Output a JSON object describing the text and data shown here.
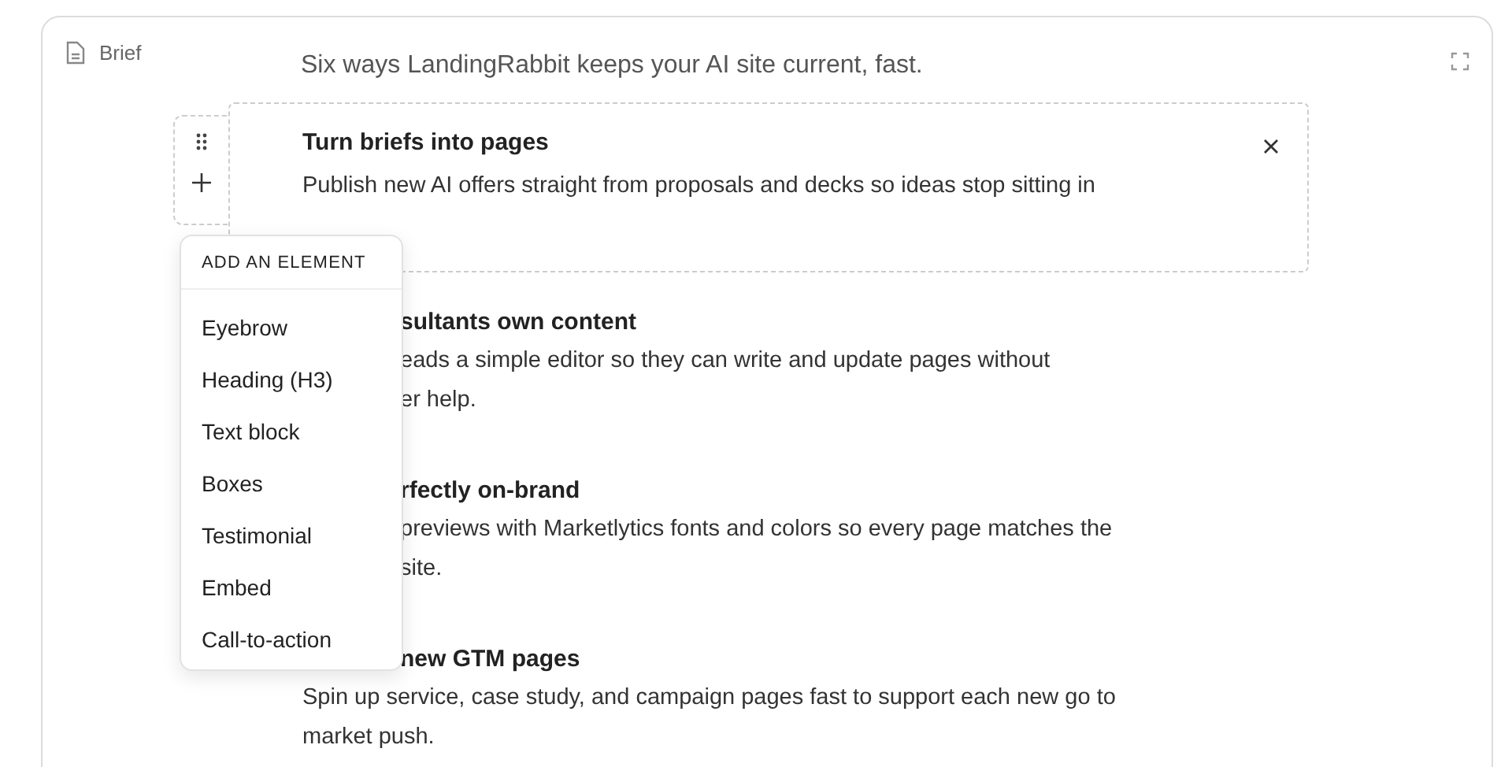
{
  "panel": {
    "label": "Brief",
    "subtitle": "Six ways LandingRabbit keeps your AI site current, fast."
  },
  "active_block": {
    "heading": "Turn briefs into pages",
    "body": "Publish new AI offers straight from proposals and decks so ideas stop sitting in"
  },
  "sections": [
    {
      "heading": {
        "text": "sultants own content",
        "kind": "behind-menu"
      },
      "lines": [
        {
          "text": "eads a simple editor so they can write and update pages without",
          "kind": "behind-menu"
        },
        {
          "text": "er help.",
          "kind": "behind-menu"
        }
      ]
    },
    {
      "heading": {
        "text": "rfectly on-brand",
        "kind": "behind-menu"
      },
      "lines": [
        {
          "text": "previews with Marketlytics fonts and colors so every page matches the",
          "kind": "behind-menu"
        },
        {
          "text": "site.",
          "kind": "behind-menu"
        }
      ]
    },
    {
      "heading": {
        "text": "new GTM pages",
        "kind": "behind-menu"
      },
      "lines": [
        {
          "text": "Spin up service, case study, and campaign pages fast to support each new go to",
          "kind": "full"
        },
        {
          "text": "market push.",
          "kind": "full"
        }
      ]
    }
  ],
  "menu": {
    "title": "ADD AN ELEMENT",
    "items": [
      "Eyebrow",
      "Heading (H3)",
      "Text block",
      "Boxes",
      "Testimonial",
      "Embed",
      "Call-to-action"
    ]
  }
}
